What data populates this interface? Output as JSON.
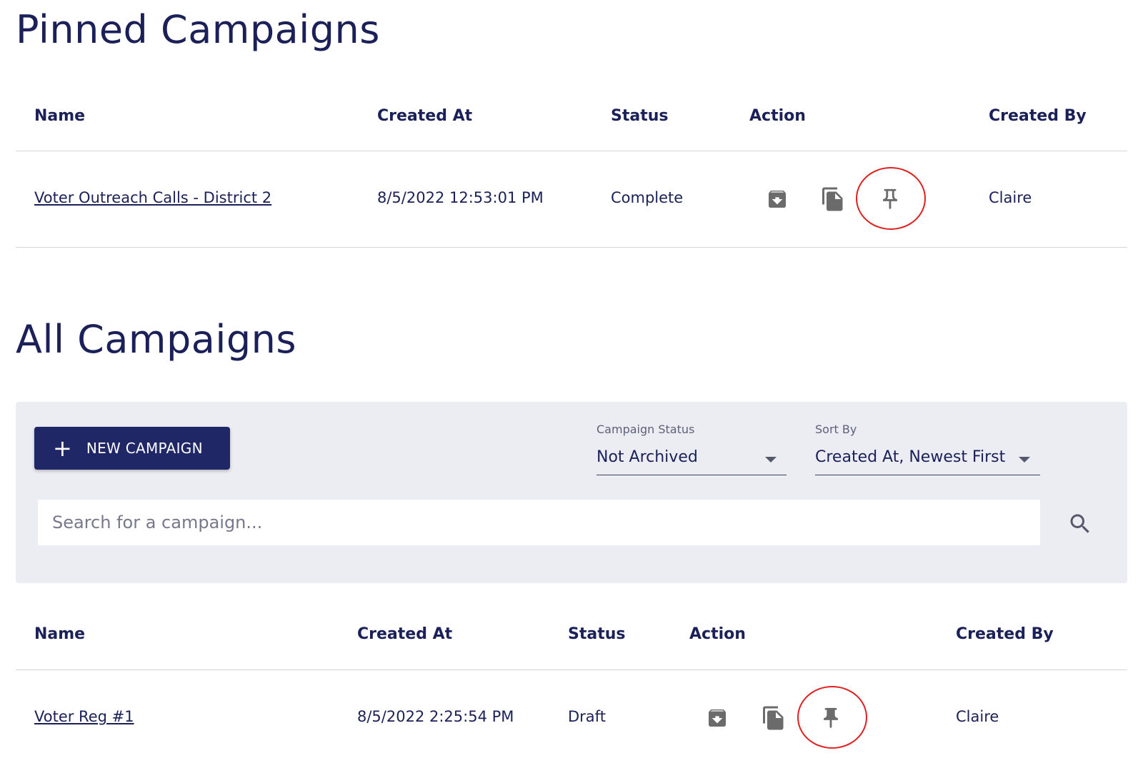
{
  "pinned": {
    "title": "Pinned Campaigns",
    "columns": [
      "Name",
      "Created At",
      "Status",
      "Action",
      "Created By"
    ],
    "rows": [
      {
        "name": "Voter Outreach Calls - District 2",
        "created_at": "8/5/2022 12:53:01 PM",
        "status": "Complete",
        "created_by": "Claire",
        "pinned": true
      }
    ]
  },
  "all": {
    "title": "All Campaigns",
    "new_button": "NEW CAMPAIGN",
    "status_filter": {
      "label": "Campaign Status",
      "value": "Not Archived"
    },
    "sort_filter": {
      "label": "Sort By",
      "value": "Created At, Newest First"
    },
    "search_placeholder": "Search for a campaign...",
    "columns": [
      "Name",
      "Created At",
      "Status",
      "Action",
      "Created By"
    ],
    "rows": [
      {
        "name": "Voter Reg #1",
        "created_at": "8/5/2022 2:25:54 PM",
        "status": "Draft",
        "created_by": "Claire",
        "pinned": false
      }
    ]
  },
  "icons": {
    "archive": "archive-icon",
    "copy": "copy-icon",
    "pin_outline": "pin-outline-icon",
    "pin_filled": "pin-filled-icon",
    "search": "search-icon",
    "add": "plus-icon"
  },
  "colors": {
    "navy": "#1b2158",
    "button": "#1f2766",
    "filter_bg": "#ececf3",
    "icon_gray": "#6b6b6b",
    "highlight_ring": "#e02020"
  }
}
